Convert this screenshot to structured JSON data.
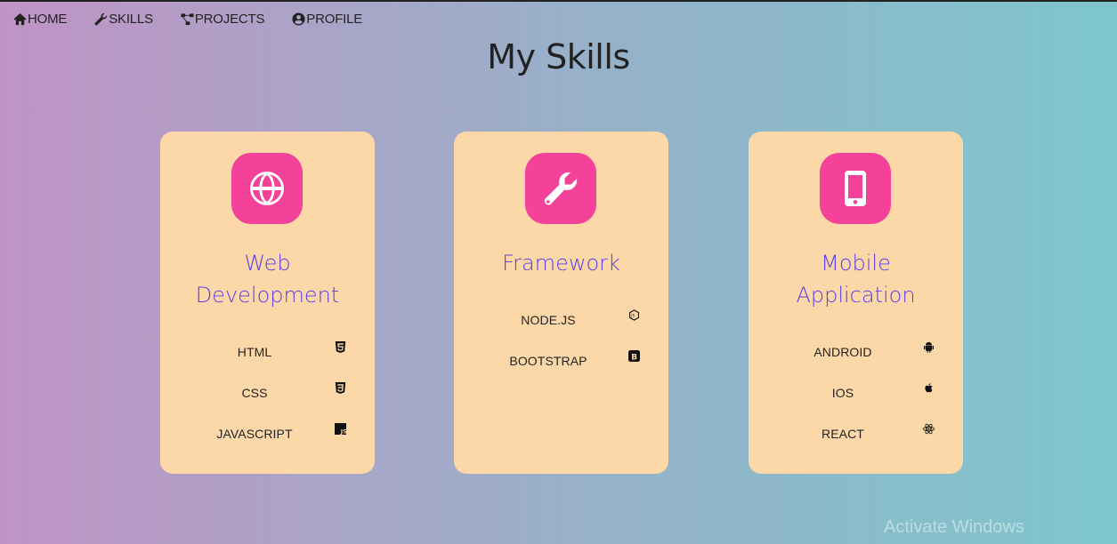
{
  "nav": {
    "items": [
      {
        "label": "HOME",
        "icon": "home-icon"
      },
      {
        "label": "SKILLS",
        "icon": "wrench-icon"
      },
      {
        "label": "PROJECTS",
        "icon": "project-diagram-icon"
      },
      {
        "label": "PROFILE",
        "icon": "user-circle-icon"
      }
    ]
  },
  "page": {
    "title": "My Skills"
  },
  "cards": [
    {
      "title": "Web Development",
      "icon": "globe-icon",
      "skills": [
        {
          "name": "HTML",
          "icon": "html5-icon"
        },
        {
          "name": "CSS",
          "icon": "css3-icon"
        },
        {
          "name": "JAVASCRIPT",
          "icon": "js-icon"
        }
      ]
    },
    {
      "title": "Framework",
      "icon": "wrench-icon",
      "skills": [
        {
          "name": "NODE.JS",
          "icon": "nodejs-icon"
        },
        {
          "name": "BOOTSTRAP",
          "icon": "bootstrap-icon"
        }
      ]
    },
    {
      "title": "Mobile Application",
      "icon": "mobile-phone-icon",
      "skills": [
        {
          "name": "ANDROID",
          "icon": "android-icon"
        },
        {
          "name": "IOS",
          "icon": "apple-icon"
        },
        {
          "name": "REACT",
          "icon": "react-icon"
        }
      ]
    }
  ],
  "colors": {
    "card_bg": "#fcd8a8",
    "icon_bg": "#f4419a",
    "title_color": "#5b3ee8",
    "gradient_start": "#c093c6",
    "gradient_end": "#7ec6cc"
  },
  "overlay": {
    "watermark": "Activate Windows"
  }
}
